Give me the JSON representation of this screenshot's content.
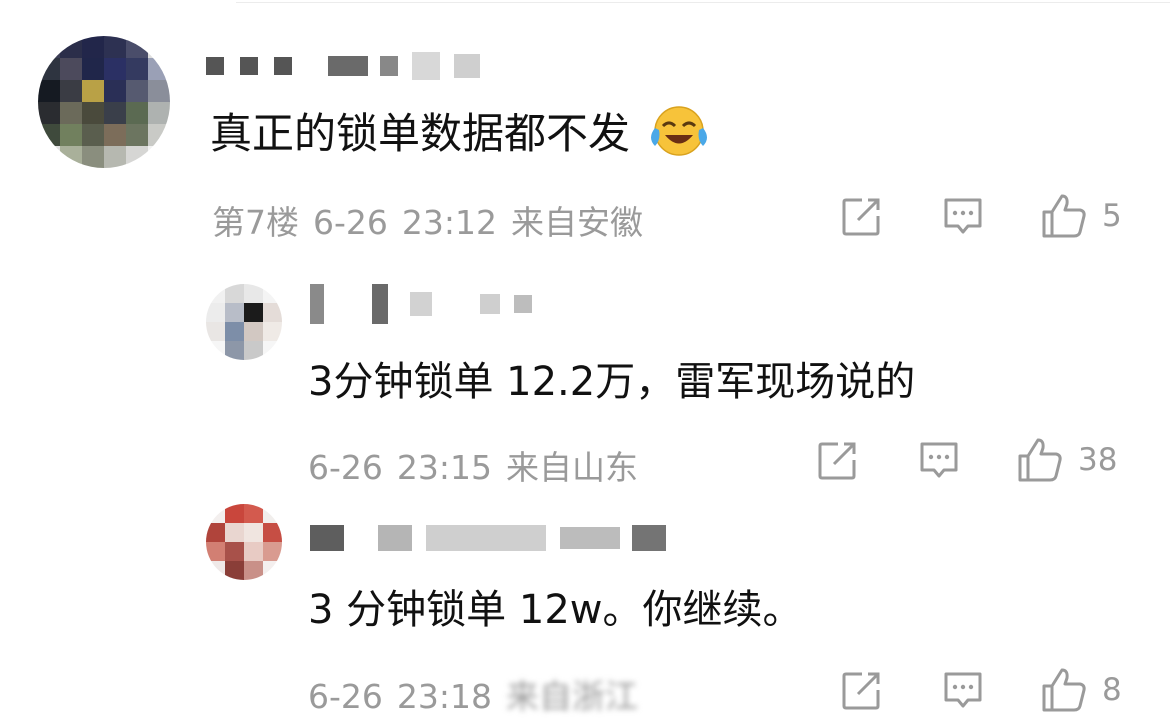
{
  "comments": [
    {
      "content": "真正的锁单数据都不发",
      "emoji_icon": "crying-laughing-emoji-icon",
      "floor": "第7楼",
      "date": "6-26",
      "time": "23:12",
      "location": "来自安徽",
      "likes": "5"
    },
    {
      "content": "3分钟锁单 12.2万，雷军现场说的",
      "date": "6-26",
      "time": "23:15",
      "location": "来自山东",
      "likes": "38"
    },
    {
      "content": "3 分钟锁单 12w。你继续。",
      "date": "6-26",
      "time": "23:18",
      "location": "来自浙江",
      "likes": "8"
    }
  ],
  "icons": {
    "share": "share-icon",
    "reply": "comment-icon",
    "like": "thumbs-up-icon"
  },
  "colors": {
    "text": "#111111",
    "meta": "#9a9a9a",
    "emoji_face": "#f7c33a",
    "emoji_tears": "#4aa8e8"
  }
}
